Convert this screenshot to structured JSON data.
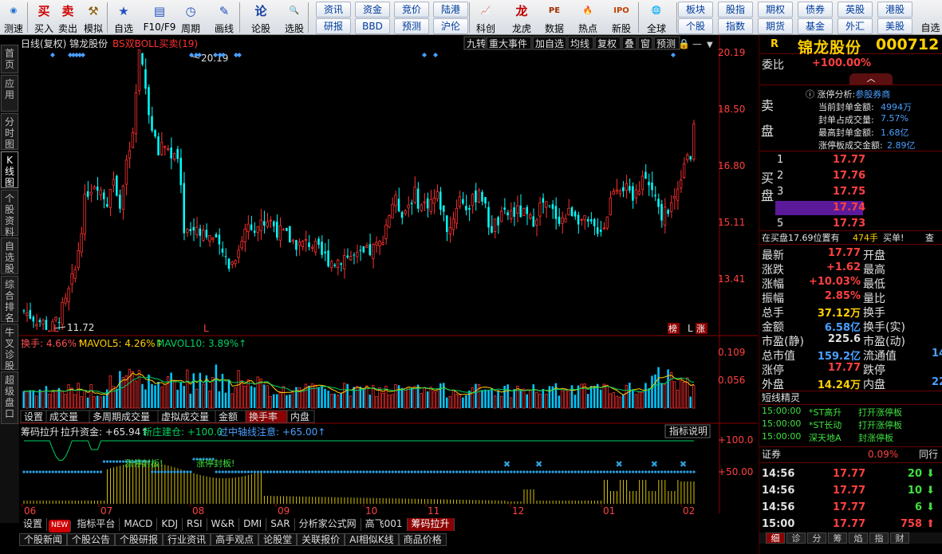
{
  "toolbar": {
    "items": [
      {
        "label": "测速",
        "icon": "speedometer-icon",
        "name": "speedtest"
      },
      {
        "label": "买入",
        "icon": "buy-icon",
        "glyph": "买",
        "name": "buy"
      },
      {
        "label": "卖出",
        "icon": "sell-icon",
        "glyph": "卖",
        "name": "sell"
      },
      {
        "label": "模拟",
        "icon": "gavel-icon",
        "glyph": "⚒",
        "name": "simulate"
      },
      {
        "label": "自选",
        "icon": "star-icon",
        "glyph": "★",
        "name": "watchlist"
      },
      {
        "label": "F10/F9",
        "icon": "f10-icon",
        "glyph": "▤",
        "name": "f10"
      },
      {
        "label": "周期",
        "icon": "clock-icon",
        "glyph": "◷",
        "name": "period"
      },
      {
        "label": "画线",
        "icon": "pen-icon",
        "glyph": "✎",
        "name": "drawline"
      },
      {
        "label": "论股",
        "icon": "discuss-icon",
        "glyph": "论",
        "name": "discuss"
      },
      {
        "label": "选股",
        "icon": "magnifier-icon",
        "glyph": "🔍",
        "name": "pick"
      },
      {
        "label": "科创",
        "icon": "chart-icon",
        "glyph": "📈",
        "name": "kechuang"
      },
      {
        "label": "龙虎",
        "icon": "dragon-icon",
        "glyph": "龙",
        "name": "longhu"
      },
      {
        "label": "数据",
        "icon": "pe-icon",
        "glyph": "PE",
        "name": "data"
      },
      {
        "label": "热点",
        "icon": "hot-icon",
        "glyph": "🔥",
        "name": "hot"
      },
      {
        "label": "新股",
        "icon": "ipo-icon",
        "glyph": "IPO",
        "name": "ipo"
      },
      {
        "label": "全球",
        "icon": "globe-icon",
        "glyph": "🌐",
        "name": "global"
      }
    ],
    "grid1": [
      [
        "资讯",
        "资金",
        "竞价",
        "陆港"
      ],
      [
        "研报",
        "BBD",
        "预测",
        "沪伦"
      ]
    ],
    "grid2": [
      [
        "板块",
        "股指",
        "期权",
        "债券",
        "英股",
        "港股"
      ],
      [
        "个股",
        "指数",
        "期货",
        "基金",
        "外汇",
        "美股"
      ]
    ],
    "self": "自选"
  },
  "lefttabs": [
    "首页",
    "应用",
    "分时图",
    "K线图",
    "个股资料",
    "自选股",
    "综合排名",
    "牛叉诊股",
    "超级盘口"
  ],
  "chart": {
    "header": "日线(复权)  锦龙股份",
    "indicator": "BS双BOLL买卖(19)",
    "buttons": [
      "九转",
      "重大事件",
      "加自选",
      "均线",
      "复权",
      "叠",
      "窗",
      "预测"
    ],
    "price_labels": [
      "20.19",
      "18.50",
      "16.80",
      "15.11",
      "13.41"
    ],
    "high_label": "20.19",
    "low_label": "11.72",
    "markers": [
      "L",
      "榜",
      "L",
      "涨"
    ],
    "vol_header": {
      "a": "换手: 4.66%↑",
      "b": "MAVOL5: 4.26%↑",
      "c": "MAVOL10: 3.89%↑"
    },
    "vol_labels": [
      "0.109",
      "0.056"
    ],
    "vol_tabs": [
      "设置",
      "成交量",
      "多周期成交量",
      "虚拟成交量",
      "金额",
      "换手率",
      "内盘"
    ],
    "ind_header": {
      "a": "筹码拉升",
      "b": "拉升资金: +65.94↑",
      "c": "新庄建仓: +100.0",
      "d": "过中轴线注意: +65.00↑"
    },
    "ind_btn": "指标说明",
    "ind_labels": [
      "+100.0",
      "+50.00"
    ],
    "ind_notes": [
      "涨停封板!",
      "涨停封板!"
    ],
    "months": [
      "06",
      "07",
      "08",
      "09",
      "10",
      "11",
      "12",
      "01",
      "02"
    ]
  },
  "chart_data": {
    "type": "candlestick",
    "x": [
      "06",
      "07",
      "08",
      "09",
      "10",
      "11",
      "12",
      "01",
      "02"
    ],
    "ylim": [
      11.72,
      20.19
    ],
    "high": 20.19,
    "low": 11.72,
    "last": 17.77
  },
  "bottom": {
    "tabs": [
      "设置",
      "NEW",
      "指标平台",
      "MACD",
      "KDJ",
      "RSI",
      "W&R",
      "DMI",
      "SAR",
      "分析家公式网",
      "高飞001",
      "筹码拉升"
    ],
    "tabs2": [
      "个股新闻",
      "个股公告",
      "个股研报",
      "行业资讯",
      "高手观点",
      "论股堂",
      "关联报价",
      "AI相似K线",
      "商品价格"
    ]
  },
  "side": {
    "code_tag": "R",
    "name": "锦龙股份",
    "code": "000712",
    "wb_label": "委比",
    "wb": "+100.00%",
    "zt_title": "涨停分析:",
    "zt_link": "参股券商",
    "zt_rows": [
      [
        "当前封单金额:",
        "4994万"
      ],
      [
        "封单占成交量:",
        "7.57%"
      ],
      [
        "最高封单金额:",
        "1.68亿"
      ],
      [
        "涨停板成交金额:",
        "2.89亿"
      ]
    ],
    "sell": "卖盘",
    "buy": "买盘",
    "bids": [
      [
        "1",
        "17.77"
      ],
      [
        "2",
        "17.76"
      ],
      [
        "3",
        "17.75"
      ],
      [
        "4",
        "17.74"
      ],
      [
        "5",
        "17.73"
      ]
    ],
    "bar_text": "在买盘17.69位置有",
    "bar_num": "474手",
    "bar_tail": "买单!",
    "bar_q": "查",
    "quote": [
      [
        "最新",
        "17.77",
        "开盘",
        ""
      ],
      [
        "涨跌",
        "+1.62",
        "最高",
        ""
      ],
      [
        "涨幅",
        "+10.03%",
        "最低",
        ""
      ],
      [
        "振幅",
        "2.85%",
        "量比",
        ""
      ],
      [
        "总手",
        "37.12万",
        "换手",
        ""
      ],
      [
        "金额",
        "6.58亿",
        "换手(实)",
        ""
      ],
      [
        "市盈(静)",
        "225.6",
        "市盈(动)",
        ""
      ],
      [
        "总市值",
        "159.2亿",
        "流通值",
        "14"
      ],
      [
        "涨停",
        "17.77",
        "跌停",
        ""
      ],
      [
        "外盘",
        "14.24万",
        "内盘",
        "22"
      ]
    ],
    "elf_title": "短线精灵",
    "elf": [
      [
        "15:00:00",
        "*ST高升",
        "打开涨停板"
      ],
      [
        "15:00:00",
        "*ST长动",
        "打开涨停板"
      ],
      [
        "15:00:00",
        "深天地A",
        "封涨停板"
      ]
    ],
    "sec_label": "证券",
    "sec_pct": "0.09%",
    "sec_tail": "同行",
    "ticks": [
      [
        "14:56",
        "17.77",
        "20"
      ],
      [
        "14:56",
        "17.77",
        "10"
      ],
      [
        "14:56",
        "17.77",
        "6"
      ],
      [
        "15:00",
        "17.77",
        "758"
      ]
    ],
    "tabs": [
      "细",
      "诊",
      "分",
      "筹",
      "焰",
      "指",
      "财"
    ]
  }
}
